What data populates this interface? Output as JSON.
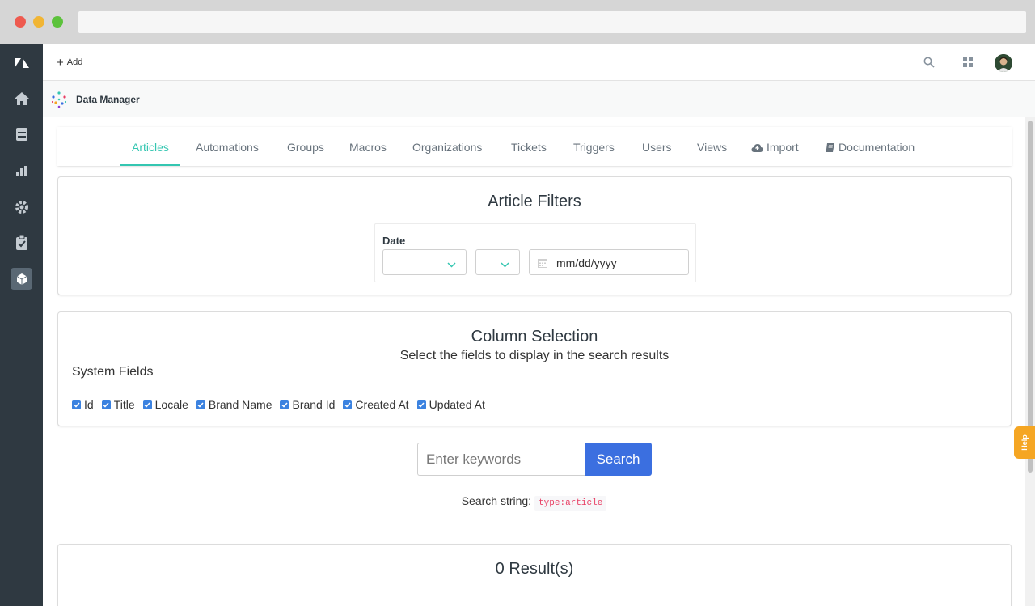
{
  "topbar": {
    "add_label": "Add"
  },
  "app": {
    "title": "Data Manager"
  },
  "tabs": [
    {
      "label": "Articles"
    },
    {
      "label": "Automations"
    },
    {
      "label": "Groups"
    },
    {
      "label": "Macros"
    },
    {
      "label": "Organizations"
    },
    {
      "label": "Tickets"
    },
    {
      "label": "Triggers"
    },
    {
      "label": "Users"
    },
    {
      "label": "Views"
    },
    {
      "label": "Import"
    },
    {
      "label": "Documentation"
    }
  ],
  "filters": {
    "title": "Article Filters",
    "date_label": "Date",
    "date_placeholder": "mm/dd/yyyy"
  },
  "columns": {
    "title": "Column Selection",
    "subtitle": "Select the fields to display in the search results",
    "system_fields_label": "System Fields",
    "fields": [
      {
        "label": "Id",
        "checked": true
      },
      {
        "label": "Title",
        "checked": true
      },
      {
        "label": "Locale",
        "checked": true
      },
      {
        "label": "Brand Name",
        "checked": true
      },
      {
        "label": "Brand Id",
        "checked": true
      },
      {
        "label": "Created At",
        "checked": true
      },
      {
        "label": "Updated At",
        "checked": true
      }
    ]
  },
  "search": {
    "placeholder": "Enter keywords",
    "button_label": "Search",
    "string_label": "Search string:",
    "string_value": "type:article"
  },
  "results": {
    "title": "0 Result(s)"
  },
  "help": {
    "label": "Help"
  },
  "colors": {
    "accent_green": "#34c6b1",
    "primary_blue": "#3b6fe0",
    "sidebar": "#2f3941",
    "help_orange": "#f5a623",
    "code_red": "#e83e63"
  }
}
